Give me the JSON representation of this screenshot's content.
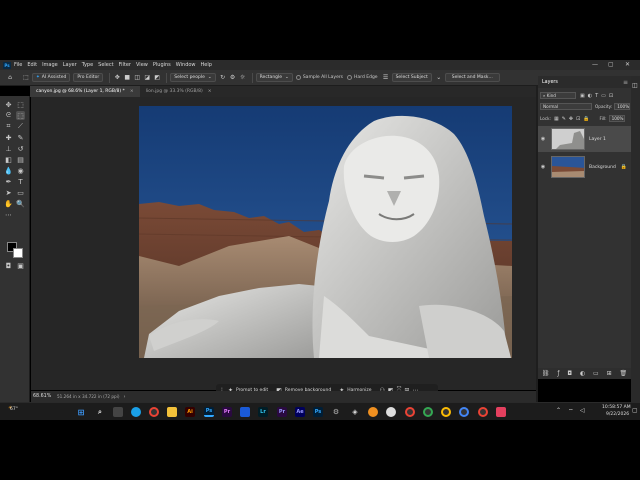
{
  "app": {
    "logo": "Ps",
    "menu": [
      "File",
      "Edit",
      "Image",
      "Layer",
      "Type",
      "Select",
      "Filter",
      "View",
      "Plugins",
      "Window",
      "Help"
    ],
    "window_controls": {
      "minimize": "—",
      "maximize": "▢",
      "close": "✕"
    }
  },
  "options_bar": {
    "ai_assisted": "AI Assisted",
    "pro_editor": "Pro Editor",
    "select_people": "Select people",
    "mode": "Rectangle",
    "sample_all_layers": "Sample All Layers",
    "hard_edge": "Hard Edge",
    "select_subject": "Select Subject",
    "select_and_mask": "Select and Mask..."
  },
  "tabs": [
    {
      "label": "canyon.jpg @ 68.6% (Layer 1, RGB/8) *",
      "active": true
    },
    {
      "label": "lion.jpg @ 33.3% (RGB/8)",
      "active": false
    }
  ],
  "context_bar": {
    "prompt": "Prompt to edit",
    "remove_bg": "Remove background",
    "harmonize": "Harmonize"
  },
  "status": {
    "zoom": "68.61%",
    "doc_size": "51.264 in x 34.722 in (72 ppi)"
  },
  "layers_panel": {
    "title": "Layers",
    "kind": "Kind",
    "blend_mode": "Normal",
    "opacity_label": "Opacity:",
    "opacity": "100%",
    "lock_label": "Lock:",
    "fill_label": "Fill:",
    "fill": "100%",
    "layers": [
      {
        "name": "Layer 1",
        "selected": true
      },
      {
        "name": "Background",
        "selected": false,
        "locked": true
      }
    ]
  },
  "taskbar": {
    "weather_temp": "67°",
    "time": "10:58:57 AM",
    "date": "9/22/2026",
    "apps": [
      "Ai",
      "Ps",
      "Pr",
      "Lr",
      "Pr",
      "Ae",
      "Ps"
    ]
  },
  "colors": {
    "accent": "#31a8ff",
    "sky": "#1a3d73",
    "panel": "#323232"
  }
}
